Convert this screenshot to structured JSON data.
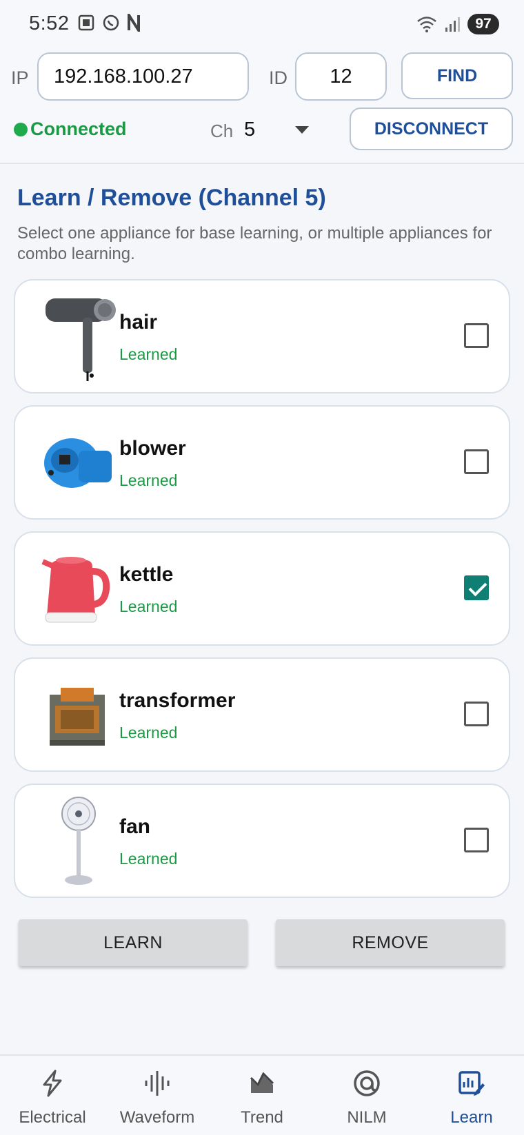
{
  "status_bar": {
    "time": "5:52",
    "battery": "97",
    "icons": [
      "screenshot-icon",
      "whatsapp-icon",
      "n-app-icon",
      "wifi-icon",
      "signal-icon"
    ]
  },
  "connection": {
    "ip_label": "IP",
    "ip_value": "192.168.100.27",
    "id_label": "ID",
    "id_value": "12",
    "find_label": "FIND",
    "status": "Connected",
    "channel_label": "Ch",
    "channel_value": "5",
    "disconnect_label": "DISCONNECT"
  },
  "main": {
    "title": "Learn / Remove (Channel 5)",
    "description": "Select one appliance for base learning, or multiple appliances for combo learning.",
    "appliances": [
      {
        "name": "hair",
        "status": "Learned",
        "checked": false,
        "icon": "hair-dryer-icon"
      },
      {
        "name": "blower",
        "status": "Learned",
        "checked": false,
        "icon": "air-blower-icon"
      },
      {
        "name": "kettle",
        "status": "Learned",
        "checked": true,
        "icon": "kettle-icon"
      },
      {
        "name": "transformer",
        "status": "Learned",
        "checked": false,
        "icon": "transformer-icon"
      },
      {
        "name": "fan",
        "status": "Learned",
        "checked": false,
        "icon": "fan-icon"
      }
    ],
    "learn_label": "LEARN",
    "remove_label": "REMOVE"
  },
  "nav": {
    "items": [
      {
        "label": "Electrical",
        "icon": "lightning-icon",
        "active": false
      },
      {
        "label": "Waveform",
        "icon": "waveform-icon",
        "active": false
      },
      {
        "label": "Trend",
        "icon": "trend-icon",
        "active": false
      },
      {
        "label": "NILM",
        "icon": "target-icon",
        "active": false
      },
      {
        "label": "Learn",
        "icon": "learn-icon",
        "active": true
      }
    ]
  },
  "colors": {
    "accent": "#1f4f99",
    "connected": "#1a9a44",
    "checkbox_checked": "#0e7f72"
  }
}
